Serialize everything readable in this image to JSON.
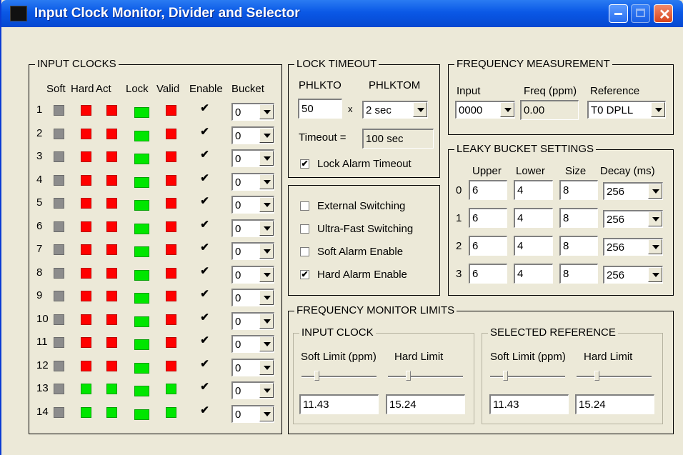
{
  "window": {
    "title": "Input Clock Monitor, Divider and Selector"
  },
  "input_clocks": {
    "legend": "INPUT CLOCKS",
    "headers": [
      "Soft",
      "Hard",
      "Act",
      "Lock",
      "Valid",
      "Enable",
      "Bucket"
    ],
    "rows": [
      {
        "n": "1",
        "soft": "grey",
        "hard": "red",
        "act": "red",
        "lock": "green",
        "valid": "red",
        "enable": "✔",
        "bucket": "0"
      },
      {
        "n": "2",
        "soft": "grey",
        "hard": "red",
        "act": "red",
        "lock": "green",
        "valid": "red",
        "enable": "✔",
        "bucket": "0"
      },
      {
        "n": "3",
        "soft": "grey",
        "hard": "red",
        "act": "red",
        "lock": "green",
        "valid": "red",
        "enable": "✔",
        "bucket": "0"
      },
      {
        "n": "4",
        "soft": "grey",
        "hard": "red",
        "act": "red",
        "lock": "green",
        "valid": "red",
        "enable": "✔",
        "bucket": "0"
      },
      {
        "n": "5",
        "soft": "grey",
        "hard": "red",
        "act": "red",
        "lock": "green",
        "valid": "red",
        "enable": "✔",
        "bucket": "0"
      },
      {
        "n": "6",
        "soft": "grey",
        "hard": "red",
        "act": "red",
        "lock": "green",
        "valid": "red",
        "enable": "✔",
        "bucket": "0"
      },
      {
        "n": "7",
        "soft": "grey",
        "hard": "red",
        "act": "red",
        "lock": "green",
        "valid": "red",
        "enable": "✔",
        "bucket": "0"
      },
      {
        "n": "8",
        "soft": "grey",
        "hard": "red",
        "act": "red",
        "lock": "green",
        "valid": "red",
        "enable": "✔",
        "bucket": "0"
      },
      {
        "n": "9",
        "soft": "grey",
        "hard": "red",
        "act": "red",
        "lock": "green",
        "valid": "red",
        "enable": "✔",
        "bucket": "0"
      },
      {
        "n": "10",
        "soft": "grey",
        "hard": "red",
        "act": "red",
        "lock": "green",
        "valid": "red",
        "enable": "✔",
        "bucket": "0"
      },
      {
        "n": "11",
        "soft": "grey",
        "hard": "red",
        "act": "red",
        "lock": "green",
        "valid": "red",
        "enable": "✔",
        "bucket": "0"
      },
      {
        "n": "12",
        "soft": "grey",
        "hard": "red",
        "act": "red",
        "lock": "green",
        "valid": "red",
        "enable": "✔",
        "bucket": "0"
      },
      {
        "n": "13",
        "soft": "grey",
        "hard": "green",
        "act": "green",
        "lock": "green",
        "valid": "green",
        "enable": "✔",
        "bucket": "0"
      },
      {
        "n": "14",
        "soft": "grey",
        "hard": "green",
        "act": "green",
        "lock": "green",
        "valid": "green",
        "enable": "✔",
        "bucket": "0"
      }
    ]
  },
  "lock_timeout": {
    "legend": "LOCK TIMEOUT",
    "phlkto_label": "PHLKTO",
    "phlktom_label": "PHLKTOM",
    "phlkto_value": "50",
    "times": "x",
    "phlktom_value": "2 sec",
    "timeout_label": "Timeout =",
    "timeout_value": "100 sec",
    "lock_alarm_label": "Lock Alarm Timeout",
    "lock_alarm_check": "✔"
  },
  "switching": {
    "items": [
      {
        "label": "External Switching",
        "check": ""
      },
      {
        "label": "Ultra-Fast Switching",
        "check": ""
      },
      {
        "label": "Soft Alarm Enable",
        "check": ""
      },
      {
        "label": "Hard Alarm Enable",
        "check": "✔"
      }
    ]
  },
  "freq_measurement": {
    "legend": "FREQUENCY MEASUREMENT",
    "input_label": "Input",
    "freq_label": "Freq (ppm)",
    "ref_label": "Reference",
    "input_value": "0000",
    "freq_value": "0.00",
    "ref_value": "T0 DPLL"
  },
  "leaky_bucket": {
    "legend": "LEAKY BUCKET SETTINGS",
    "headers": [
      "Upper",
      "Lower",
      "Size",
      "Decay (ms)"
    ],
    "rows": [
      {
        "n": "0",
        "upper": "6",
        "lower": "4",
        "size": "8",
        "decay": "256"
      },
      {
        "n": "1",
        "upper": "6",
        "lower": "4",
        "size": "8",
        "decay": "256"
      },
      {
        "n": "2",
        "upper": "6",
        "lower": "4",
        "size": "8",
        "decay": "256"
      },
      {
        "n": "3",
        "upper": "6",
        "lower": "4",
        "size": "8",
        "decay": "256"
      }
    ]
  },
  "freq_monitor": {
    "legend": "FREQUENCY MONITOR LIMITS",
    "input_clock": {
      "legend": "INPUT CLOCK",
      "soft_label": "Soft Limit (ppm)",
      "hard_label": "Hard Limit",
      "soft_value": "11.43",
      "hard_value": "15.24"
    },
    "selected_ref": {
      "legend": "SELECTED REFERENCE",
      "soft_label": "Soft Limit (ppm)",
      "hard_label": "Hard Limit",
      "soft_value": "11.43",
      "hard_value": "15.24"
    }
  }
}
